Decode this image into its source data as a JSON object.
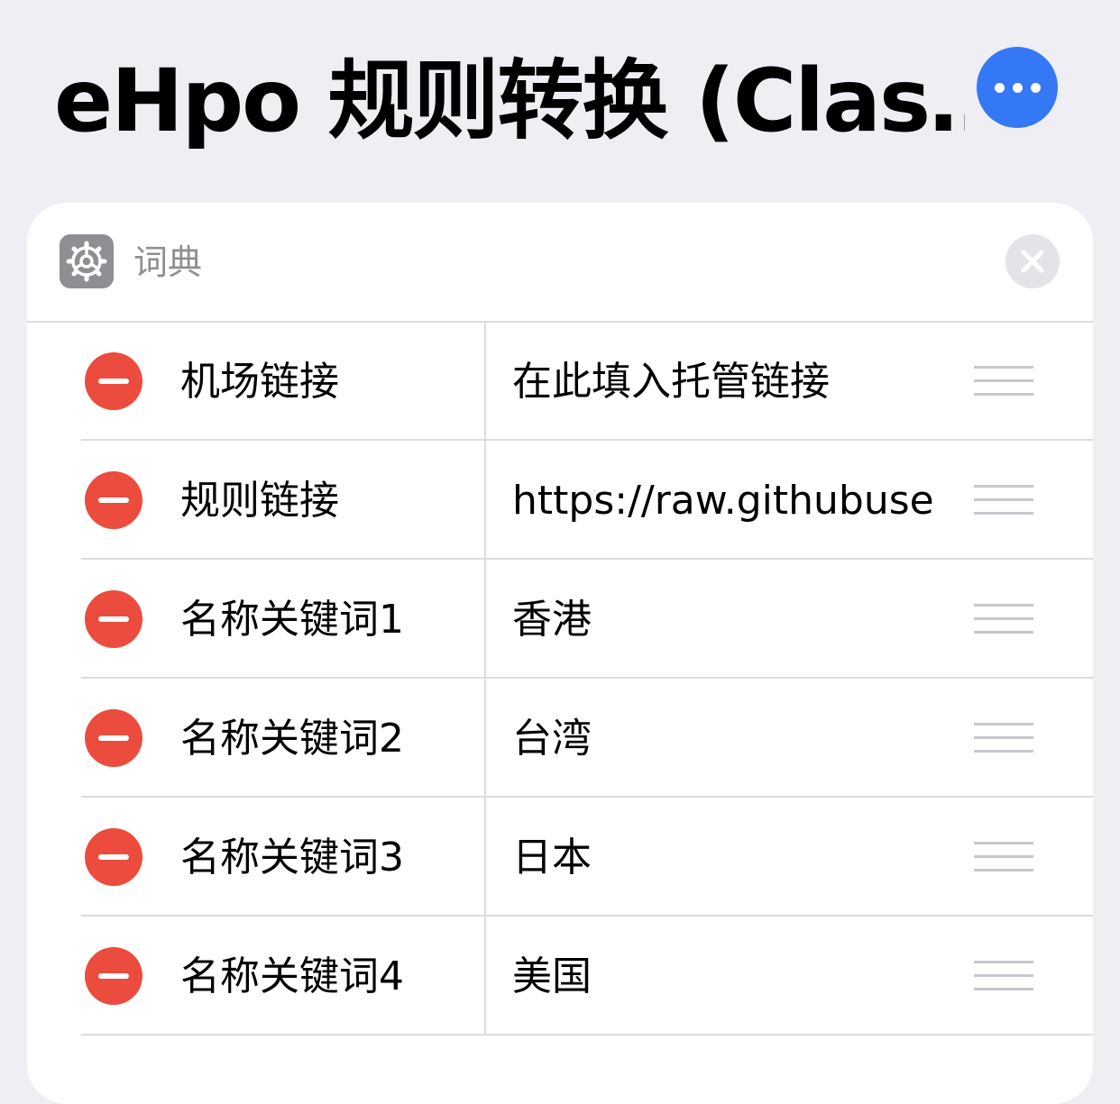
{
  "header": {
    "title": "eHpo 规则转换 (Clas…",
    "more_icon": "ellipsis-icon",
    "accent_color": "#3478f6"
  },
  "card": {
    "icon": "gear-icon",
    "title": "词典",
    "close_icon": "close-icon"
  },
  "rows": [
    {
      "key": "机场链接",
      "value": "在此填入托管链接"
    },
    {
      "key": "规则链接",
      "value": "https://raw.githubuse…"
    },
    {
      "key": "名称关键词1",
      "value": "香港"
    },
    {
      "key": "名称关键词2",
      "value": "台湾"
    },
    {
      "key": "名称关键词3",
      "value": "日本"
    },
    {
      "key": "名称关键词4",
      "value": "美国"
    }
  ],
  "colors": {
    "delete": "#eb4c3d",
    "background": "#eeeef3"
  }
}
